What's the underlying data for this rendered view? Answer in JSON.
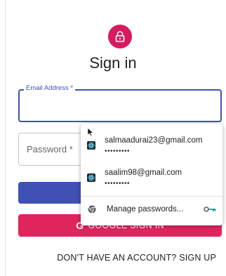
{
  "title": "Sign in",
  "email_field": {
    "label": "Email Address *",
    "value": ""
  },
  "password_field": {
    "label": "Password *",
    "value": ""
  },
  "signin_button": {
    "label": ""
  },
  "google_button": {
    "icon": "G",
    "label": "GOOGLE SIGN IN"
  },
  "signup_link": {
    "label": "DON'T HAVE AN ACCOUNT? SIGN UP"
  },
  "password_popup": {
    "credentials": [
      {
        "email": "salmaadurai23@gmail.com",
        "masked_password": "•••••••••"
      },
      {
        "email": "saalim98@gmail.com",
        "masked_password": "•••••••••"
      }
    ],
    "manage_label": "Manage passwords..."
  },
  "colors": {
    "primary": "#3f51b5",
    "accent": "#d81b60",
    "google_button": "#e0245e"
  },
  "icons": [
    "lock-icon",
    "cursor-icon",
    "react-icon",
    "chrome-icon",
    "key-icon"
  ]
}
